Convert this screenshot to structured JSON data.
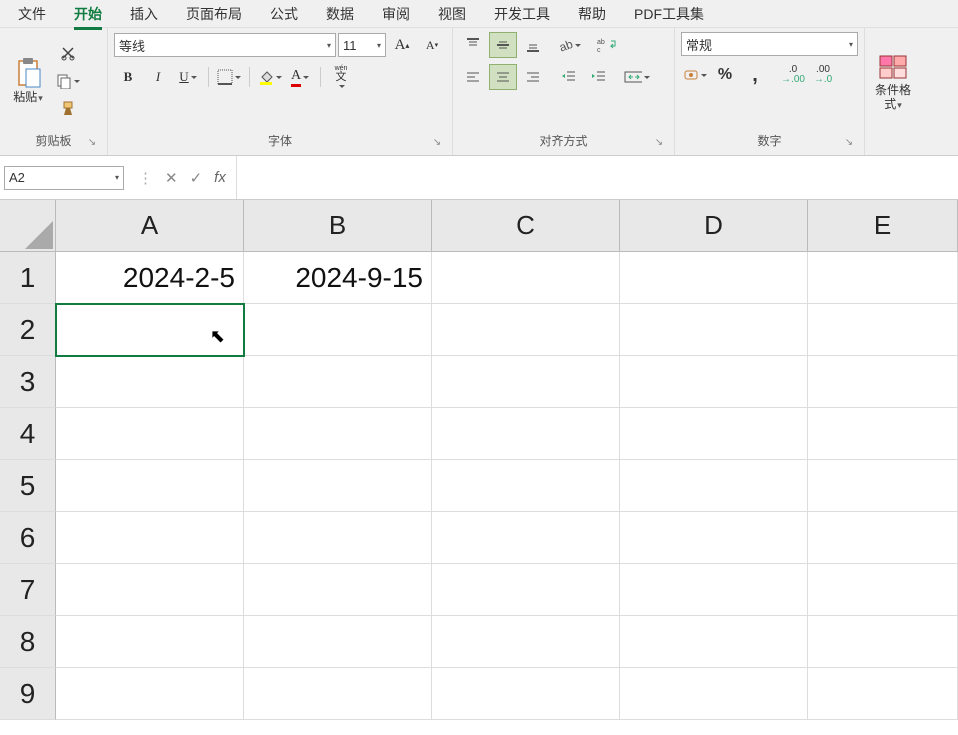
{
  "menu": {
    "items": [
      "文件",
      "开始",
      "插入",
      "页面布局",
      "公式",
      "数据",
      "审阅",
      "视图",
      "开发工具",
      "帮助",
      "PDF工具集"
    ],
    "activeIndex": 1
  },
  "ribbon": {
    "clipboard": {
      "label": "剪贴板",
      "paste": "粘贴"
    },
    "font": {
      "label": "字体",
      "name": "等线",
      "size": "11",
      "bold": "B",
      "italic": "I",
      "underline": "U",
      "phonetic": "wén"
    },
    "align": {
      "label": "对齐方式"
    },
    "number": {
      "label": "数字",
      "format": "常规"
    },
    "cond": {
      "label": "条件格式"
    }
  },
  "formula": {
    "nameBox": "A2",
    "cancel": "✕",
    "confirm": "✓",
    "fx": "fx",
    "value": ""
  },
  "grid": {
    "columns": [
      "A",
      "B",
      "C",
      "D",
      "E"
    ],
    "rows": [
      "1",
      "2",
      "3",
      "4",
      "5",
      "6",
      "7",
      "8",
      "9"
    ],
    "data": {
      "A1": "2024-2-5",
      "B1": "2024-9-15"
    },
    "selected": "A2",
    "cursor": {
      "row": 2,
      "col": "A"
    }
  }
}
